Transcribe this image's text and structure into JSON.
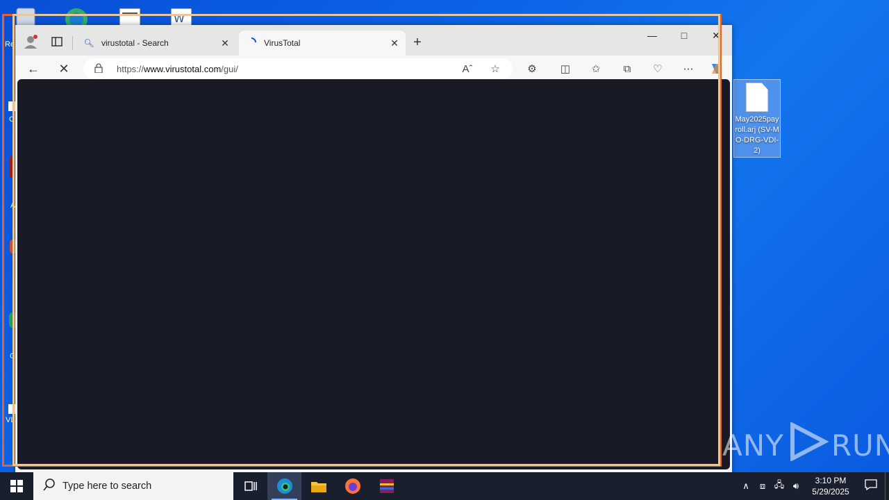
{
  "browser": {
    "tabs": [
      {
        "title": "virustotal - Search",
        "active": false,
        "icon": "search-icon"
      },
      {
        "title": "VirusTotal",
        "active": true,
        "icon": "loading-spinner-icon"
      }
    ],
    "address": {
      "prefix": "https://",
      "host": "www.virustotal.com",
      "path": "/gui/"
    },
    "page_state": "loading"
  },
  "desktop": {
    "file_label": "May2025payroll.arj (SV-MO-DRG-VDI-2)",
    "left_labels": [
      "Re",
      "C",
      "A",
      "C",
      "VL"
    ]
  },
  "taskbar": {
    "search_placeholder": "Type here to search",
    "clock_time": "3:10 PM",
    "clock_date": "5/29/2025",
    "apps": [
      "task-view",
      "edge",
      "file-explorer",
      "firefox",
      "winrar"
    ]
  },
  "watermark": {
    "left": "ANY",
    "right": "RUN"
  },
  "colors": {
    "page_bg": "#181a26",
    "highlight_outer": "#e8612c",
    "highlight_inner": "#e8c89a",
    "desktop": "#0b63e6"
  }
}
